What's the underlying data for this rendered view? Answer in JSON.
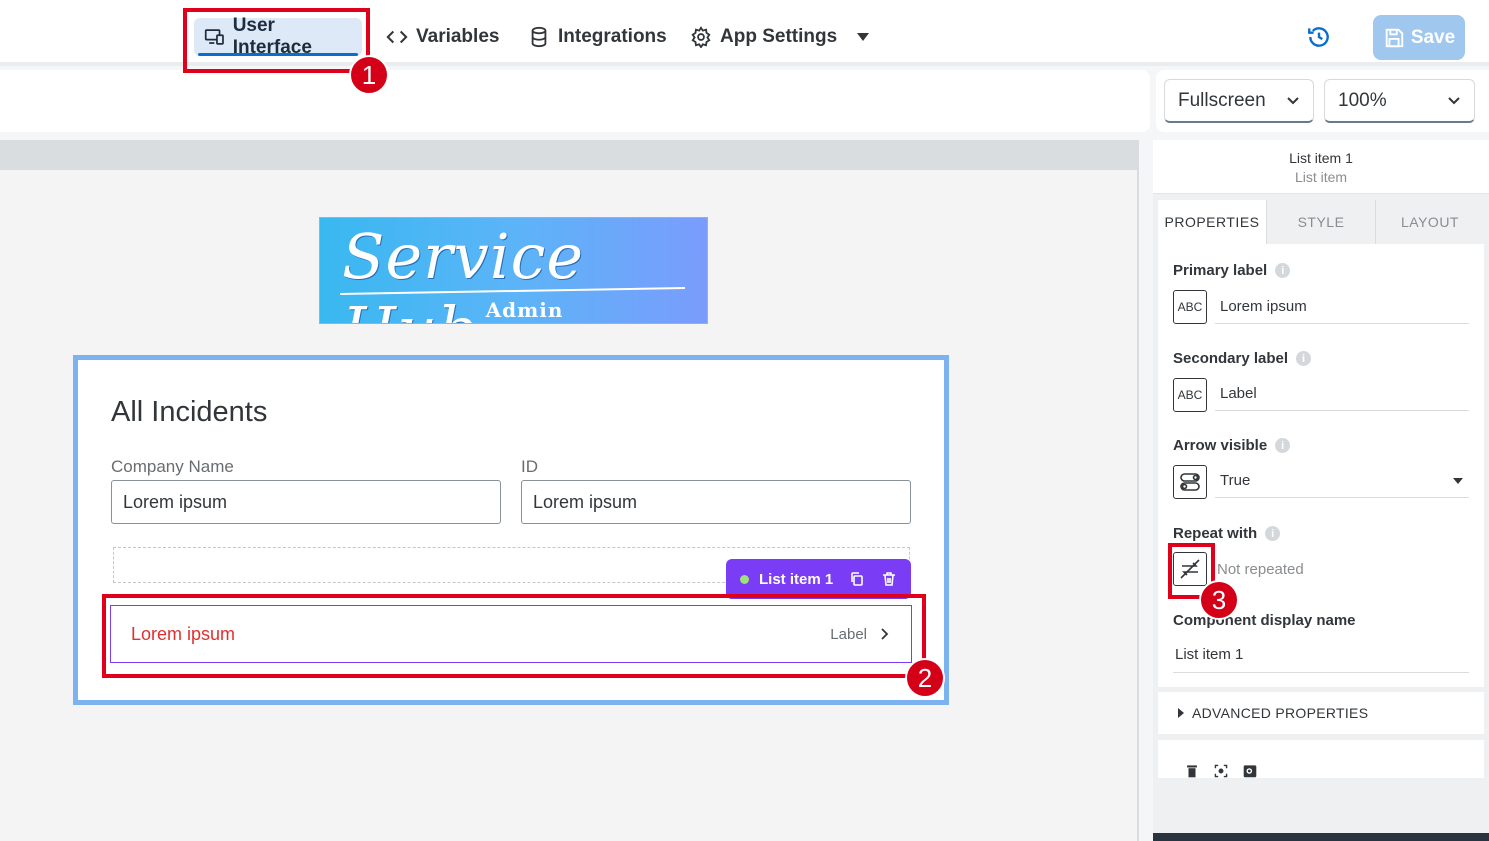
{
  "toolbar": {
    "user_interface": "User Interface",
    "variables": "Variables",
    "integrations": "Integrations",
    "app_settings": "App Settings",
    "save": "Save",
    "history_icon": "history-icon"
  },
  "viewbar": {
    "device": "Fullscreen",
    "zoom": "100%"
  },
  "canvas": {
    "logo": {
      "title": "Service Hub",
      "subtitle": "Admin"
    },
    "card_title": "All Incidents",
    "fields": [
      {
        "label": "Company Name",
        "value": "Lorem ipsum"
      },
      {
        "label": "ID",
        "value": "Lorem ipsum"
      }
    ],
    "list_item_tag": "List item 1",
    "list_item": {
      "primary": "Lorem ipsum",
      "secondary": "Label"
    }
  },
  "annotations": [
    "1",
    "2",
    "3"
  ],
  "panel": {
    "component_name": "List item 1",
    "component_type": "List item",
    "tabs": [
      "PROPERTIES",
      "STYLE",
      "LAYOUT"
    ],
    "primary_label": {
      "label": "Primary label",
      "value": "Lorem ipsum"
    },
    "secondary_label": {
      "label": "Secondary label",
      "value": "Label"
    },
    "arrow_visible": {
      "label": "Arrow visible",
      "value": "True"
    },
    "repeat_with": {
      "label": "Repeat with",
      "value": "Not repeated"
    },
    "display_name": {
      "label": "Component display name",
      "value": "List item 1"
    },
    "advanced": "ADVANCED PROPERTIES",
    "binding_text": "ABC",
    "info": "i"
  },
  "colors": {
    "accent": "#0a6ed1",
    "highlight": "#e0001c",
    "selection": "#7a3cf5",
    "save_disabled": "#a0c8ef"
  }
}
